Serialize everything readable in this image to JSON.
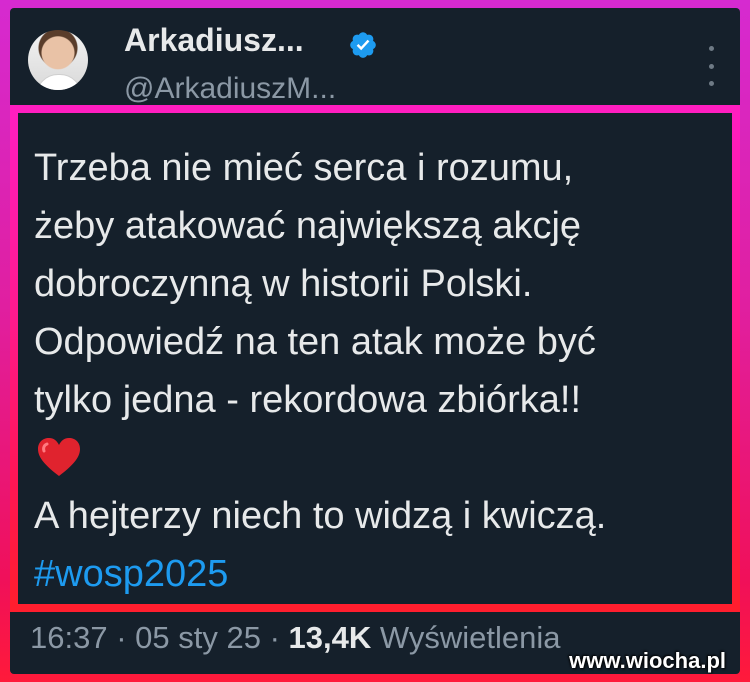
{
  "tweet": {
    "author_name": "Arkadiusz...",
    "author_handle": "@ArkadiuszM...",
    "verified_icon": "verified-badge-icon",
    "more_icon": "more-vertical-icon",
    "text_lines": [
      "Trzeba nie mieć serca i rozumu,",
      "żeby atakować największą akcję",
      "dobroczynną w historii Polski.",
      "Odpowiedź na ten atak może być",
      "tylko jedna - rekordowa zbiórka!!"
    ],
    "emoji": "heart-emoji",
    "closing_line": "A hejterzy niech to widzą i kwiczą.",
    "hashtag": "#wosp2025",
    "time": "16:37",
    "date": "05 sty 25",
    "separator": "·",
    "views_count": "13,4K",
    "views_label": "Wyświetlenia"
  },
  "watermark": "www.wiocha.pl",
  "colors": {
    "card_bg": "#15202b",
    "text": "#e7e9ea",
    "muted": "#8b98a5",
    "link": "#1d9bf0",
    "frame_top": "#d62ad0",
    "frame_bottom": "#ff1a3a"
  }
}
